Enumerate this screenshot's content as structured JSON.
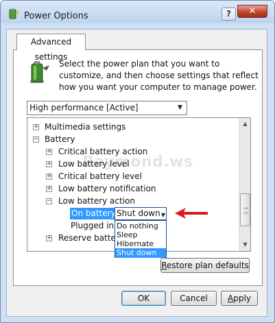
{
  "window": {
    "title": "Power Options"
  },
  "title_buttons": {
    "help": "?",
    "close": "✕"
  },
  "tab": {
    "label": "Advanced settings"
  },
  "description": "Select the power plan that you want to customize, and then choose settings that reflect how you want your computer to manage power.",
  "plan_select": {
    "value": "High performance [Active]"
  },
  "watermark": "Raymond.ws",
  "tree": {
    "items": [
      {
        "label": "Multimedia settings",
        "expander": "+"
      },
      {
        "label": "Battery",
        "expander": "−"
      },
      {
        "label": "Critical battery action",
        "expander": "+"
      },
      {
        "label": "Low battery level",
        "expander": "+"
      },
      {
        "label": "Critical battery level",
        "expander": "+"
      },
      {
        "label": "Low battery notification",
        "expander": "+"
      },
      {
        "label": "Low battery action",
        "expander": "−"
      },
      {
        "label": "On battery:"
      },
      {
        "label": "Plugged in:"
      },
      {
        "label": "Reserve battery",
        "expander": "+"
      }
    ]
  },
  "on_battery_select": {
    "value": "Shut down"
  },
  "dropdown_options": [
    "Do nothing",
    "Sleep",
    "Hibernate",
    "Shut down"
  ],
  "selected_option": "Shut down",
  "buttons": {
    "restore_prefix": "",
    "restore_underlined": "R",
    "restore_rest": "estore plan defaults",
    "ok": "OK",
    "cancel": "Cancel",
    "apply_underlined": "A",
    "apply_rest": "pply"
  },
  "colors": {
    "selection": "#3399ff",
    "arrow": "#e01818"
  }
}
